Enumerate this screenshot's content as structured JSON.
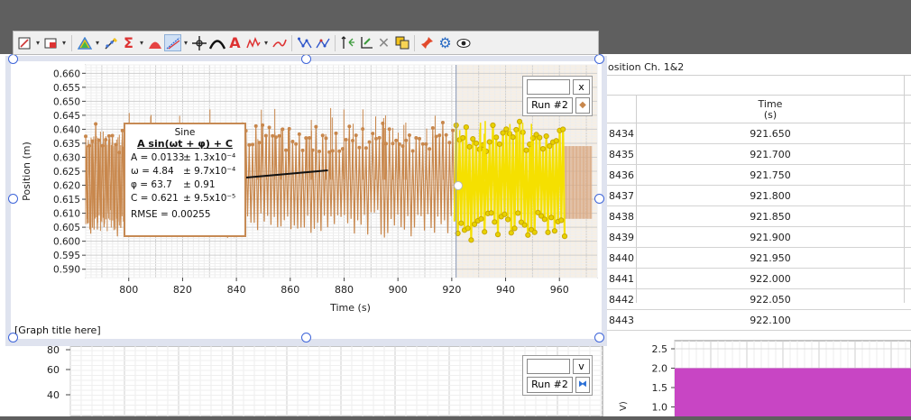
{
  "toolbar": {
    "buttons": [
      "autoscale-icon",
      "select-region-icon",
      "graph-options-icon",
      "draw-prediction-icon",
      "statistics-icon",
      "integral-icon",
      "tangent-icon",
      "examine-icon",
      "peak-icon",
      "annotation-icon",
      "derivative-icon",
      "curve-fit-icon",
      "connect-points-icon",
      "join-points-icon",
      "interpolate-icon",
      "model-icon",
      "strike-through-icon",
      "remove-icon",
      "copy-icon",
      "pin-icon",
      "settings-icon",
      "view-icon"
    ]
  },
  "graph": {
    "title_placeholder": "[Graph title here]",
    "legend_upper": {
      "close": "x",
      "run": "Run #2",
      "swatch": "◆"
    },
    "legend_lower": {
      "close": "v",
      "run": "Run #2",
      "swatch": "⧓"
    }
  },
  "fit": {
    "name": "Sine",
    "equation": "A sin(ωt + φ) + C",
    "rows": [
      {
        "label": "A  = 0.0133",
        "unc": "± 1.3x10⁻⁴"
      },
      {
        "label": "ω = 4.84",
        "unc": "± 9.7x10⁻⁴"
      },
      {
        "label": "φ  = 63.7",
        "unc": "± 0.91"
      },
      {
        "label": "C  = 0.621",
        "unc": "± 9.5x10⁻⁵"
      }
    ],
    "rmse": "RMSE = 0.00255"
  },
  "chart_data": {
    "type": "line",
    "xlabel": "Time (s)",
    "ylabel": "Position (m)",
    "xlim": [
      784,
      974
    ],
    "ylim": [
      0.587,
      0.663
    ],
    "x_ticks": [
      800,
      820,
      840,
      860,
      880,
      900,
      920,
      940,
      960
    ],
    "y_ticks": [
      "0.590",
      "0.595",
      "0.600",
      "0.605",
      "0.610",
      "0.615",
      "0.620",
      "0.625",
      "0.630",
      "0.635",
      "0.640",
      "0.645",
      "0.650",
      "0.655",
      "0.660"
    ],
    "series": [
      {
        "name": "Run #2",
        "color": "#c8874c"
      },
      {
        "color": "#f5e000"
      }
    ],
    "selection_start": 921.6,
    "data_end": 962,
    "fit_band_end": 972
  },
  "lower_graph": {
    "left_ticks": [
      "80",
      "60",
      "40"
    ],
    "right_ticks": [
      "2.5",
      "2.0",
      "1.5",
      "1.0"
    ],
    "right_ylabel_fragment": "V)",
    "bar_color": "#c845c4",
    "bar_value": 2.0
  },
  "table": {
    "title": "osition Ch. 1&2",
    "col_header": "Time",
    "col_unit": "(s)",
    "rows": [
      {
        "id": "8434",
        "time": "921.650"
      },
      {
        "id": "8435",
        "time": "921.700"
      },
      {
        "id": "8436",
        "time": "921.750"
      },
      {
        "id": "8437",
        "time": "921.800"
      },
      {
        "id": "8438",
        "time": "921.850"
      },
      {
        "id": "8439",
        "time": "921.900"
      },
      {
        "id": "8440",
        "time": "921.950"
      },
      {
        "id": "8441",
        "time": "922.000"
      },
      {
        "id": "8442",
        "time": "922.050"
      },
      {
        "id": "8443",
        "time": "922.100"
      }
    ]
  }
}
